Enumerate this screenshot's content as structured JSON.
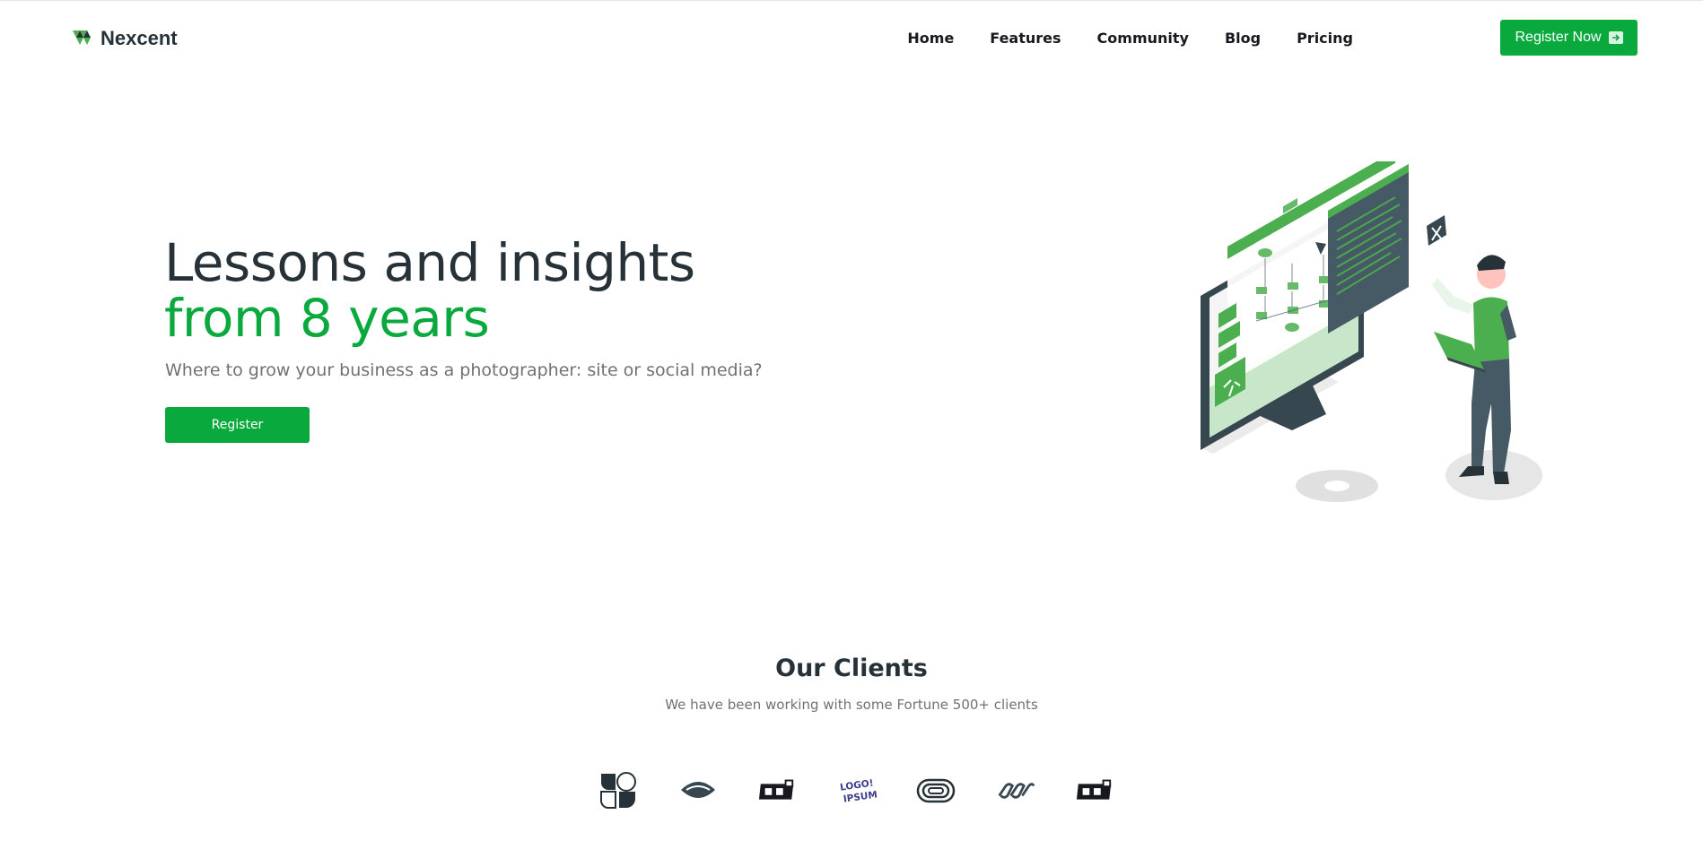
{
  "header": {
    "brand": "Nexcent",
    "nav": [
      "Home",
      "Features",
      "Community",
      "Blog",
      "Pricing"
    ],
    "cta_label": "Register Now"
  },
  "hero": {
    "title_line1": "Lessons and insights",
    "title_line2": "from 8 years",
    "subtitle": "Where to grow your business as a photographer: site or social media?",
    "button_label": "Register"
  },
  "clients": {
    "title": "Our Clients",
    "subtitle": "We have been working with some Fortune 500+ clients",
    "logos": [
      "client-logo-1",
      "client-logo-2",
      "client-logo-3",
      "client-logo-4",
      "client-logo-5",
      "client-logo-6",
      "client-logo-7"
    ],
    "logo_text": "LOGO! IPSUM"
  },
  "colors": {
    "brand_green": "#09a93d",
    "text_dark": "#263238",
    "text_muted": "#717171"
  }
}
